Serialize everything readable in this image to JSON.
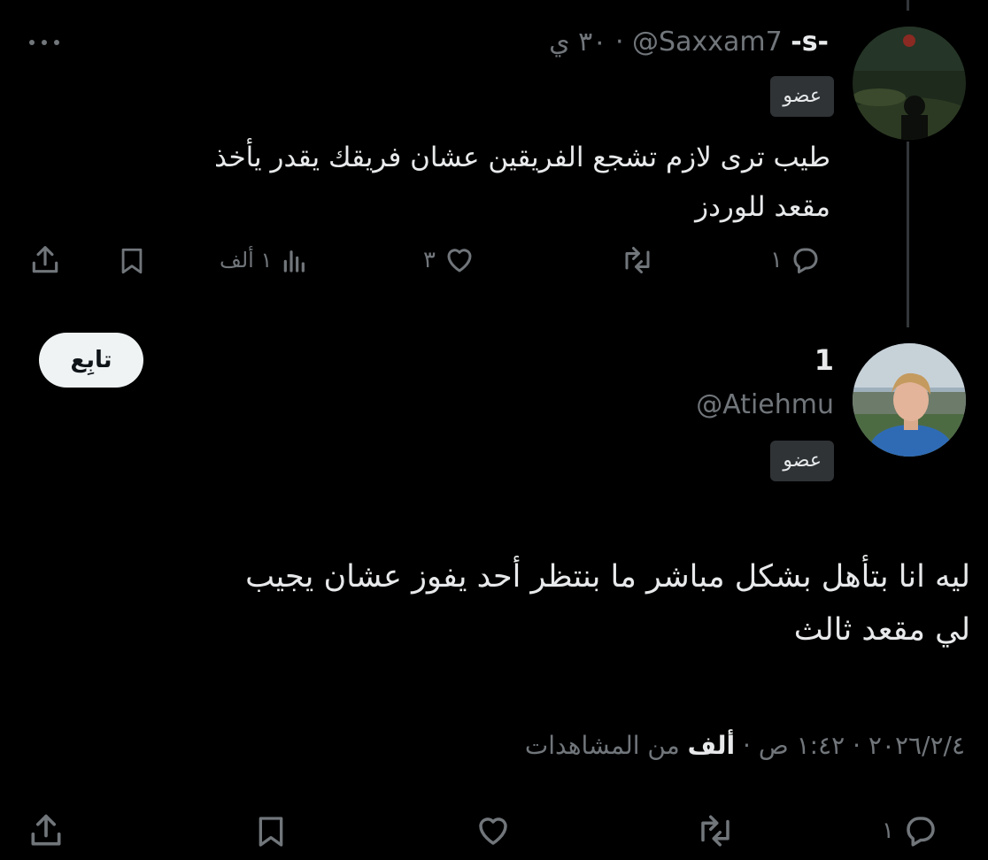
{
  "reply_tweet": {
    "display_name": "-s-",
    "handle": "@Saxxam7",
    "separator": "·",
    "time": "٣٠ ي",
    "badge": "عضو",
    "text_line1": "طيب ترى لازم تشجع الفريقين عشان فريقك يقدر يأخذ",
    "text_line2": "مقعد للوردز",
    "actions": {
      "reply_count": "١",
      "retweet_count": "",
      "like_count": "٣",
      "views_count": "١ ألف"
    }
  },
  "main_tweet": {
    "display_name": "1",
    "handle": "@Atiehmu",
    "badge": "عضو",
    "follow_label": "تابِع",
    "text_line1": "ليه انا بتأهل بشكل مباشر ما بنتظر أحد يفوز عشان يجيب",
    "text_line2": "لي مقعد ثالث",
    "meta": {
      "date": "٢٠٢٦/٢/٤",
      "time": "١:٤٢ ص",
      "views_number": "ألف",
      "views_label": "من المشاهدات",
      "separator": "·"
    },
    "actions": {
      "reply_count": "١"
    }
  },
  "colors": {
    "background": "#000000",
    "text": "#e7e9ea",
    "muted": "#71767b",
    "badge_bg": "#2f3336",
    "follow_bg": "#eff3f4"
  }
}
